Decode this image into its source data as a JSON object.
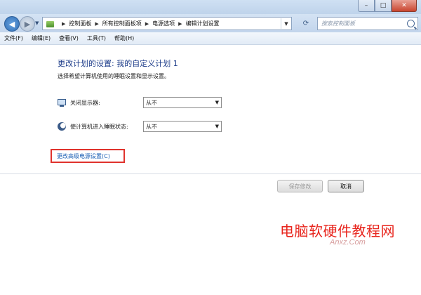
{
  "window": {
    "min_icon": "minimize-icon",
    "max_icon": "maximize-icon",
    "close_icon": "close-icon"
  },
  "nav": {
    "breadcrumbs": [
      "控制面板",
      "所有控制面板项",
      "电源选项",
      "编辑计划设置"
    ],
    "search_placeholder": "搜索控制面板"
  },
  "menu": {
    "items": [
      "文件(F)",
      "编辑(E)",
      "查看(V)",
      "工具(T)",
      "帮助(H)"
    ]
  },
  "main": {
    "title": "更改计划的设置: 我的自定义计划 1",
    "subtitle": "选择希望计算机使用的睡眠设置和显示设置。",
    "display_off": {
      "label": "关闭显示器:",
      "value": "从不"
    },
    "sleep": {
      "label": "使计算机进入睡眠状态:",
      "value": "从不"
    },
    "advanced_link": "更改高级电源设置(C)",
    "save_button": "保存修改",
    "cancel_button": "取消"
  },
  "watermark": {
    "main": "电脑软硬件教程网",
    "small": "Anxz.Com"
  },
  "colors": {
    "title": "#1e3d8a",
    "link": "#1a5fb4",
    "highlight_box": "#e0332d",
    "watermark": "#e8261e"
  }
}
